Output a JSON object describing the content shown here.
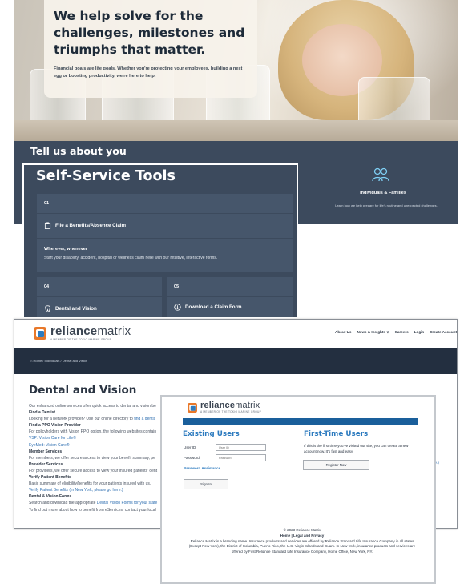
{
  "hero": {
    "headline": "We help solve for the challenges, milestones and triumphs that matter.",
    "subtext": "Financial goals are life goals. Whether you're protecting your employees, building a nest egg or boosting productivity, we're here to help."
  },
  "band": {
    "title": "Tell us about you",
    "left_note": "gs",
    "family_title": "Individuals & Families",
    "family_subtitle": "Learn how we help prepare for life's routine and unexpected challenges."
  },
  "self_service": {
    "title": "Self-Service Tools",
    "cards": [
      {
        "number": "01",
        "label": "File a Benefits/Absence Claim",
        "icon": "clipboard-icon"
      },
      {
        "number": "04",
        "label": "Dental and Vision",
        "icon": "tooth-icon"
      },
      {
        "number": "05",
        "label": "Download a Claim Form",
        "icon": "download-icon"
      }
    ],
    "tagline": "Wherever, whenever",
    "description": "Start your disability, accident, hospital or wellness claim here with our intuitive, interactive forms."
  },
  "reliance": {
    "brand_bold": "reliance",
    "brand_light": "matrix",
    "brand_tagline": "A MEMBER OF THE TOKIO MARINE GROUP",
    "nav": [
      "About Us",
      "News & Insights ∨",
      "Careers",
      "Login",
      "Create Account"
    ],
    "breadcrumb": "⌂ Home  /  Individuals  /  Dental and Vision",
    "page_title": "Dental and Vision",
    "intro": "Our enhanced online services offer quick access to dental and vision be",
    "sections": {
      "dentist_h": "Find a Dentist",
      "dentist_t": "Looking for a network provider? Use our online directory to",
      "dentist_link": "find a dentis",
      "ppo_h": "Find a PPO Vision Provider",
      "ppo_t": "For policyholders with Vision PPO option, the following websites contain",
      "ppo_link1": "VSP: Vision Care for Life®",
      "ppo_link2": "EyeMed: Vision Care®",
      "member_h": "Member Services",
      "member_t": "For members, we offer secure access to view your benefit summary, pe",
      "provider_h": "Provider Services",
      "provider_t": "For providers, we offer secure access to view your insured patients' dent",
      "verify_h": "Verify Patient Benefits",
      "verify_t": "Basic summary of eligibility/benefits for your patients insured with us.",
      "verify_link": "Verify Patient Benefits",
      "verify_ny": "(In New York, please go here.)",
      "forms_h": "Dental & Vision Forms",
      "forms_t1": "Search and download the appropriate",
      "forms_link": "Dental Vision Forms for your state",
      "forms_t2": "To find out more about how to benefit from eServices, contact your local"
    },
    "side_link1": "here.)",
    "side_link2": "s"
  },
  "login": {
    "brand_bold": "reliance",
    "brand_light": "matrix",
    "brand_tagline": "A MEMBER OF THE TOKIO MARINE GROUP",
    "existing_title": "Existing Users",
    "userid_label": "User ID",
    "userid_placeholder": "User ID",
    "password_label": "Password",
    "password_placeholder": "Password",
    "password_assist": "Password Assistance",
    "signin": "Sign In",
    "first_title": "First-Time Users",
    "first_text": "If this is the first time you've visited our site, you can create a new account now. It's fast and easy!",
    "register": "Register Now",
    "copyright": "© 2023 Reliance Matrix",
    "footer_links": "Home | Legal and Privacy",
    "footer_text": "Reliance Matrix is a branding name. Insurance products and services are offered by Reliance Standard Life Insurance Company in all states (Except New York), the District of Columbia, Puerto Rico, the U.S. Virgin Islands and Guam. In New York, insurance products and services are offered by First Reliance Standard Life Insurance Company, Home Office, New York, NY."
  },
  "colors": {
    "navy": "#3c4a5d",
    "card": "#46566b",
    "dark_bar": "#232f40",
    "link_blue": "#2f6fb1",
    "login_blue": "#1a5f9b",
    "logo_orange": "#e8782a",
    "logo_blue": "#2d7bbf"
  }
}
